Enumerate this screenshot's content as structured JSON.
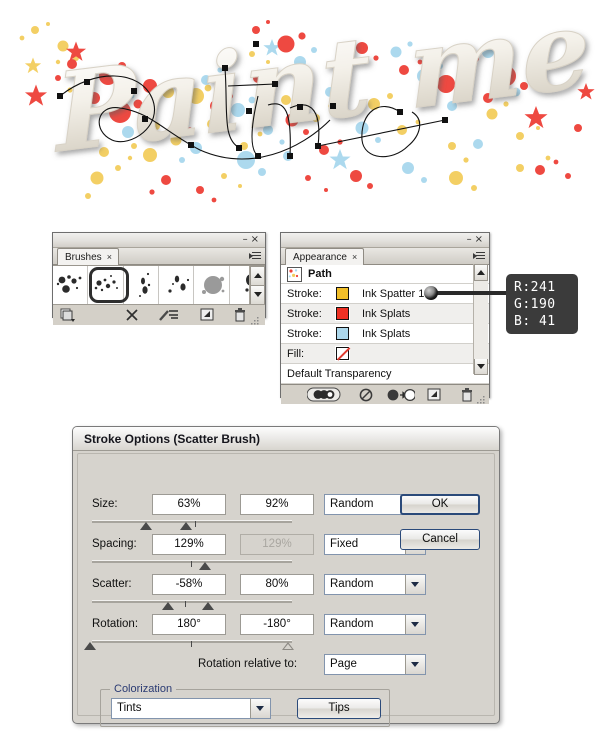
{
  "artwork": {
    "text": "Paint me",
    "description": "3D cursive lettering with red, yellow and light-blue paint splatters and a selected vector path with anchor points",
    "colors": {
      "splat_red": "#ee4037",
      "splat_yellow": "#f5cf5e",
      "splat_blue": "#a8d8ee",
      "letter": "#efece5"
    }
  },
  "brushes_panel": {
    "title": "Brushes",
    "close_label": "×",
    "minimize_label": "–",
    "swatches": [
      {
        "name": "ink-spatter-0"
      },
      {
        "name": "ink-spatter-1",
        "selected": true
      },
      {
        "name": "ink-splats-2"
      },
      {
        "name": "ink-splats-3"
      },
      {
        "name": "ink-blob-4"
      },
      {
        "name": "ink-drop-5"
      }
    ],
    "footer_icons": [
      "libraries-menu-icon",
      "remove-brush-stroke-icon",
      "options-of-selected-object-icon",
      "new-brush-icon",
      "delete-brush-icon"
    ],
    "scroll_up_icon": "chevron-up-icon",
    "scroll_down_icon": "chevron-down-icon"
  },
  "appearance_panel": {
    "title": "Appearance",
    "close_label": "×",
    "minimize_label": "–",
    "object_label": "Path",
    "rows": [
      {
        "label": "Stroke:",
        "value": "Ink Spatter 1",
        "swatch": "#f1be29",
        "kind": "color"
      },
      {
        "label": "Stroke:",
        "value": "Ink Splats",
        "swatch": "#ee3124",
        "kind": "color"
      },
      {
        "label": "Stroke:",
        "value": "Ink Splats",
        "swatch": "#add8ec",
        "kind": "color"
      },
      {
        "label": "Fill:",
        "value": "",
        "swatch": "none",
        "kind": "none"
      },
      {
        "label": "Default Transparency",
        "value": "",
        "swatch": "",
        "kind": "text"
      }
    ],
    "footer_icons": [
      "add-new-stroke-icon",
      "clear-appearance-icon",
      "reduce-to-basic-appearance-icon",
      "duplicate-selected-item-icon",
      "delete-selected-item-icon"
    ]
  },
  "callout": {
    "r_label": "R:",
    "r_value": "241",
    "g_label": "G:",
    "g_value": "190",
    "b_label": "B:",
    "b_value": " 41",
    "background": "#3b3b3b",
    "text_color": "#ffffff"
  },
  "dialog": {
    "title": "Stroke Options (Scatter Brush)",
    "fields": [
      {
        "label": "Size:",
        "min_value": "63%",
        "max_value": "92%",
        "max_disabled": false,
        "mode": "Random",
        "slider": {
          "left_pct": 27,
          "right_pct": 45,
          "tick_pct": 50,
          "left_filled": true,
          "right_filled": true
        }
      },
      {
        "label": "Spacing:",
        "min_value": "129%",
        "max_value": "129%",
        "max_disabled": true,
        "mode": "Fixed",
        "slider": {
          "left_pct": 57,
          "right_pct": 57,
          "tick_pct": 50,
          "left_filled": true,
          "right_filled": true
        }
      },
      {
        "label": "Scatter:",
        "min_value": "-58%",
        "max_value": "80%",
        "max_disabled": false,
        "mode": "Random",
        "slider": {
          "left_pct": 39,
          "right_pct": 60,
          "tick_pct": 50,
          "left_filled": true,
          "right_filled": true
        }
      },
      {
        "label": "Rotation:",
        "min_value": "180°",
        "max_value": "-180°",
        "max_disabled": false,
        "mode": "Random",
        "slider": {
          "left_pct": 0,
          "right_pct": 100,
          "tick_pct": 50,
          "left_filled": true,
          "right_filled": false
        }
      }
    ],
    "rotation_relative_label": "Rotation relative to:",
    "rotation_relative_value": "Page",
    "colorization_group_label": "Colorization",
    "colorization_value": "Tints",
    "tips_label": "Tips",
    "ok_label": "OK",
    "cancel_label": "Cancel",
    "dropdown_arrow_icon": "chevron-down-icon"
  }
}
